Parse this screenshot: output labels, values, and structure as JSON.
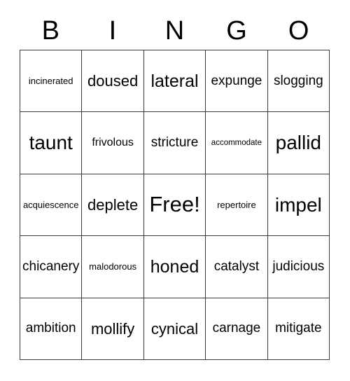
{
  "card": {
    "title_letters": [
      "B",
      "I",
      "N",
      "G",
      "O"
    ],
    "grid": {
      "rows": 5,
      "columns": 5,
      "border_color": "#3a3a3a",
      "background_color": "#ffffff",
      "text_color": "#000000",
      "cells": [
        [
          {
            "text": "incinerated",
            "size": "xxs"
          },
          {
            "text": "doused",
            "size": "m"
          },
          {
            "text": "lateral",
            "size": "l"
          },
          {
            "text": "expunge",
            "size": "s"
          },
          {
            "text": "slogging",
            "size": "s"
          }
        ],
        [
          {
            "text": "taunt",
            "size": "xl"
          },
          {
            "text": "frivolous",
            "size": "xs"
          },
          {
            "text": "stricture",
            "size": "s"
          },
          {
            "text": "accommodate",
            "size": "tiny"
          },
          {
            "text": "pallid",
            "size": "xl"
          }
        ],
        [
          {
            "text": "acquiescence",
            "size": "xxs"
          },
          {
            "text": "deplete",
            "size": "m"
          },
          {
            "text": "Free!",
            "size": "xxl"
          },
          {
            "text": "repertoire",
            "size": "xxs"
          },
          {
            "text": "impel",
            "size": "xl"
          }
        ],
        [
          {
            "text": "chicanery",
            "size": "s"
          },
          {
            "text": "malodorous",
            "size": "xxs"
          },
          {
            "text": "honed",
            "size": "l"
          },
          {
            "text": "catalyst",
            "size": "s"
          },
          {
            "text": "judicious",
            "size": "s"
          }
        ],
        [
          {
            "text": "ambition",
            "size": "s"
          },
          {
            "text": "mollify",
            "size": "m"
          },
          {
            "text": "cynical",
            "size": "m"
          },
          {
            "text": "carnage",
            "size": "s"
          },
          {
            "text": "mitigate",
            "size": "s"
          }
        ]
      ]
    }
  }
}
